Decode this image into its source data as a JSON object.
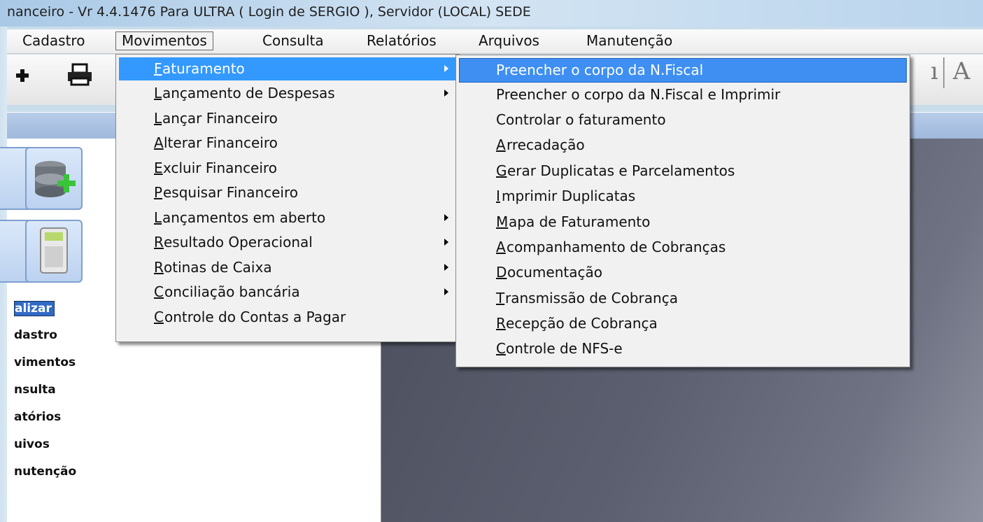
{
  "window": {
    "title": "nanceiro - Vr 4.4.1476 Para ULTRA  ( Login de SERGIO ), Servidor (LOCAL) SEDE"
  },
  "menubar": {
    "items": [
      "Cadastro",
      "Movimentos",
      "Consulta",
      "Relatórios",
      "Arquivos",
      "Manutenção"
    ],
    "open_index": 1
  },
  "toolbar": {
    "icons": [
      "plus-icon",
      "printer-icon"
    ],
    "right_fragment": "A"
  },
  "left_nav": {
    "items": [
      "alizar",
      "dastro",
      "vimentos",
      "nsulta",
      "atórios",
      "uivos",
      "nutenção"
    ],
    "selected_index": 0
  },
  "movimentos_menu": {
    "items": [
      {
        "pre": "",
        "key": "F",
        "post": "aturamento",
        "submenu": true,
        "highlighted": true
      },
      {
        "pre": "",
        "key": "L",
        "post": "ançamento de Despesas",
        "submenu": true
      },
      {
        "pre": "",
        "key": "L",
        "post": "ançar Financeiro",
        "submenu": false
      },
      {
        "pre": "",
        "key": "A",
        "post": "lterar Financeiro",
        "submenu": false
      },
      {
        "pre": "",
        "key": "E",
        "post": "xcluir Financeiro",
        "submenu": false
      },
      {
        "pre": "",
        "key": "P",
        "post": "esquisar Financeiro",
        "submenu": false
      },
      {
        "pre": "",
        "key": "L",
        "post": "ançamentos em aberto",
        "submenu": true
      },
      {
        "pre": "",
        "key": "R",
        "post": "esultado Operacional",
        "submenu": true
      },
      {
        "pre": "",
        "key": "R",
        "post": "otinas de Caixa",
        "submenu": true
      },
      {
        "pre": "",
        "key": "C",
        "post": "onciliação bancária",
        "submenu": true
      },
      {
        "pre": "",
        "key": "C",
        "post": "ontrole do Contas a Pagar",
        "submenu": false
      }
    ]
  },
  "faturamento_menu": {
    "items": [
      {
        "pre": "",
        "key": "",
        "post": "Preencher o corpo da N.Fiscal",
        "highlighted": true
      },
      {
        "pre": "",
        "key": "",
        "post": "Preencher o corpo da N.Fiscal e Imprimir"
      },
      {
        "pre": "",
        "key": "",
        "post": "Controlar o faturamento"
      },
      {
        "pre": "",
        "key": "A",
        "post": "rrecadação"
      },
      {
        "pre": "",
        "key": "G",
        "post": "erar Duplicatas e Parcelamentos"
      },
      {
        "pre": "",
        "key": "I",
        "post": "mprimir Duplicatas"
      },
      {
        "pre": "",
        "key": "M",
        "post": "apa de Faturamento"
      },
      {
        "pre": "",
        "key": "A",
        "post": "companhamento de Cobranças"
      },
      {
        "pre": "",
        "key": "D",
        "post": "ocumentação"
      },
      {
        "pre": "",
        "key": "T",
        "post": "ransmissão de Cobrança"
      },
      {
        "pre": "",
        "key": "R",
        "post": "ecepção de Cobrança"
      },
      {
        "pre": "",
        "key": "C",
        "post": "ontrole de NFS-e"
      }
    ]
  },
  "colors": {
    "highlight": "#3399ff",
    "menu_bg": "#f1f1f1",
    "desktop": "#5b5f6f",
    "titlebar": "#b9d4ec"
  }
}
